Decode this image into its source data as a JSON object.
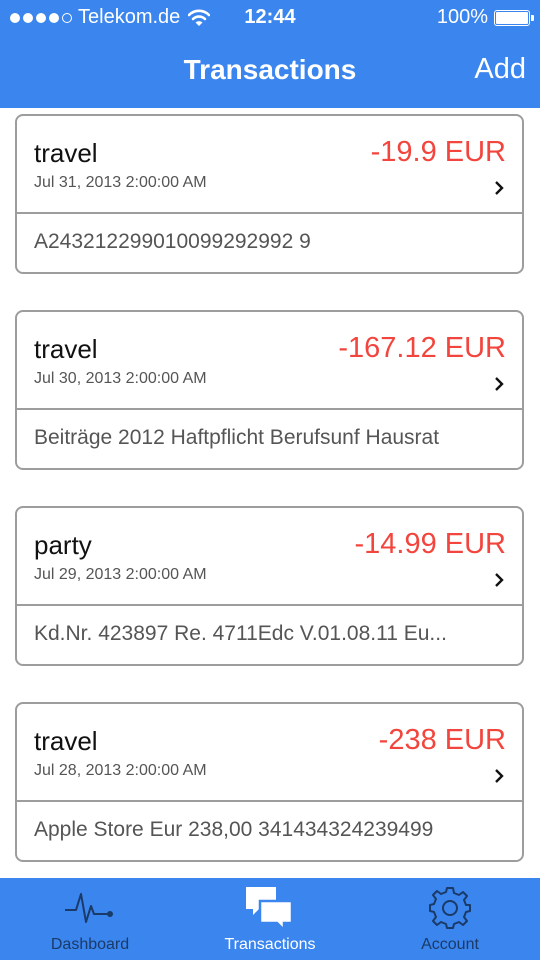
{
  "status": {
    "carrier": "Telekom.de",
    "time": "12:44",
    "battery": "100%"
  },
  "nav": {
    "title": "Transactions",
    "add_label": "Add"
  },
  "transactions": [
    {
      "category": "travel",
      "amount": "-19.9 EUR",
      "date": "Jul 31, 2013 2:00:00 AM",
      "memo": "A243212299010099292992 9"
    },
    {
      "category": "travel",
      "amount": "-167.12 EUR",
      "date": "Jul 30, 2013 2:00:00 AM",
      "memo": "Beiträge 2012 Haftpflicht Berufsunf Hausrat"
    },
    {
      "category": "party",
      "amount": "-14.99 EUR",
      "date": "Jul 29, 2013 2:00:00 AM",
      "memo": "Kd.Nr. 423897 Re. 4711Edc V.01.08.11 Eu..."
    },
    {
      "category": "travel",
      "amount": "-238 EUR",
      "date": "Jul 28, 2013 2:00:00 AM",
      "memo": "Apple Store Eur 238,00 341434324239499"
    }
  ],
  "tabbar": {
    "tabs": [
      {
        "label": "Dashboard",
        "icon": "pulse-icon",
        "active": false
      },
      {
        "label": "Transactions",
        "icon": "chat-bubbles-icon",
        "active": true
      },
      {
        "label": "Account",
        "icon": "gear-icon",
        "active": false
      }
    ]
  },
  "colors": {
    "accent": "#3b85ee",
    "amount_negative": "#f2453d",
    "inactive_tab": "#1a3a68"
  }
}
